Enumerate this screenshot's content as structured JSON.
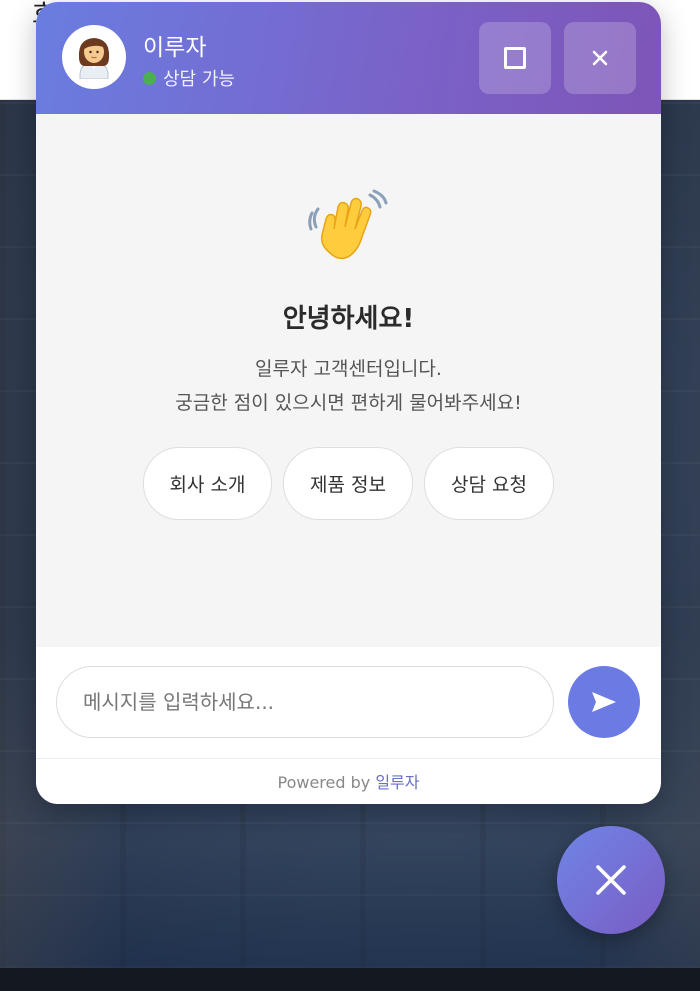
{
  "background": {
    "top_text": "호"
  },
  "chat": {
    "agent_name": "이루자",
    "status": "상담 가능",
    "greeting_emoji": "👋",
    "greeting": "안녕하세요!",
    "intro_line1": "일루자 고객센터입니다.",
    "intro_line2": "궁금한 점이 있으시면 편하게 물어봐주세요!",
    "quick_replies": [
      "회사 소개",
      "제품 정보",
      "상담 요청"
    ],
    "input_placeholder": "메시지를 입력하세요...",
    "powered_by": "Powered by",
    "brand": "일루자"
  },
  "colors": {
    "header_gradient_start": "#6a7de0",
    "header_gradient_end": "#7e55b8",
    "status_online": "#4caf50",
    "send_button": "#6b7be3",
    "brand_text": "#6a70c8"
  },
  "icons": {
    "avatar": "woman-office-worker-icon",
    "maximize": "maximize-icon",
    "close": "close-icon",
    "send": "send-arrow-icon",
    "launcher": "close-icon"
  }
}
